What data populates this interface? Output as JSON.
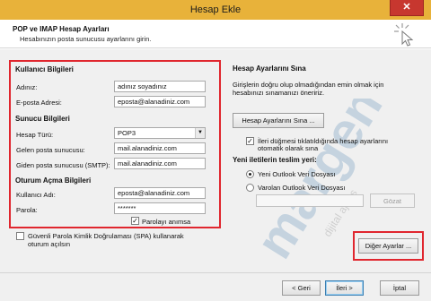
{
  "window": {
    "title": "Hesap Ekle",
    "close_glyph": "✕"
  },
  "header": {
    "title": "POP ve IMAP Hesap Ayarları",
    "subtitle": "Hesabınızın posta sunucusu ayarlarını girin."
  },
  "user_info": {
    "heading": "Kullanıcı Bilgileri",
    "name_label": "Adınız:",
    "name_value": "adınız soyadınız",
    "email_label": "E-posta Adresi:",
    "email_value": "eposta@alanadiniz.com"
  },
  "server_info": {
    "heading": "Sunucu Bilgileri",
    "account_type_label": "Hesap Türü:",
    "account_type_value": "POP3",
    "incoming_label": "Gelen posta sunucusu:",
    "incoming_value": "mail.alanadiniz.com",
    "outgoing_label": "Giden posta sunucusu (SMTP):",
    "outgoing_value": "mail.alanadiniz.com"
  },
  "logon_info": {
    "heading": "Oturum Açma Bilgileri",
    "username_label": "Kullanıcı Adı:",
    "username_value": "eposta@alanadiniz.com",
    "password_label": "Parola:",
    "password_value": "*******",
    "remember_label": "Parolayı anımsa",
    "remember_checked": true,
    "spa_label_line1": "Güvenli Parola Kimlik Doğrulaması (SPA) kullanarak",
    "spa_label_line2": "oturum açılsın",
    "spa_checked": false
  },
  "test": {
    "heading": "Hesap Ayarlarını Sına",
    "description_line1": "Girişlerin doğru olup olmadığından emin olmak için",
    "description_line2": "hesabınızı sınamanızı öneririz.",
    "test_button": "Hesap Ayarlarını Sına ...",
    "auto_test_line1": "İleri düğmesi tıklatıldığında hesap ayarlarını",
    "auto_test_line2": "otomatik olarak sına",
    "auto_test_checked": true
  },
  "delivery": {
    "heading": "Yeni iletilerin teslim yeri:",
    "new_file_label": "Yeni Outlook Veri Dosyası",
    "existing_file_label": "Varolan Outlook Veri Dosyası",
    "selected": "new",
    "browse_button": "Gözat"
  },
  "more_settings_button": "Diğer Ayarlar ...",
  "footer": {
    "back_button": "< Geri",
    "next_button": "İleri >",
    "cancel_button": "İptal"
  },
  "watermark_text": "margen",
  "watermark_sub": "dijital ajans",
  "colors": {
    "titlebar": "#e8b23a",
    "close_button": "#c7372f",
    "highlight": "#e0262e",
    "dialog_bg": "#f0f0f0"
  }
}
